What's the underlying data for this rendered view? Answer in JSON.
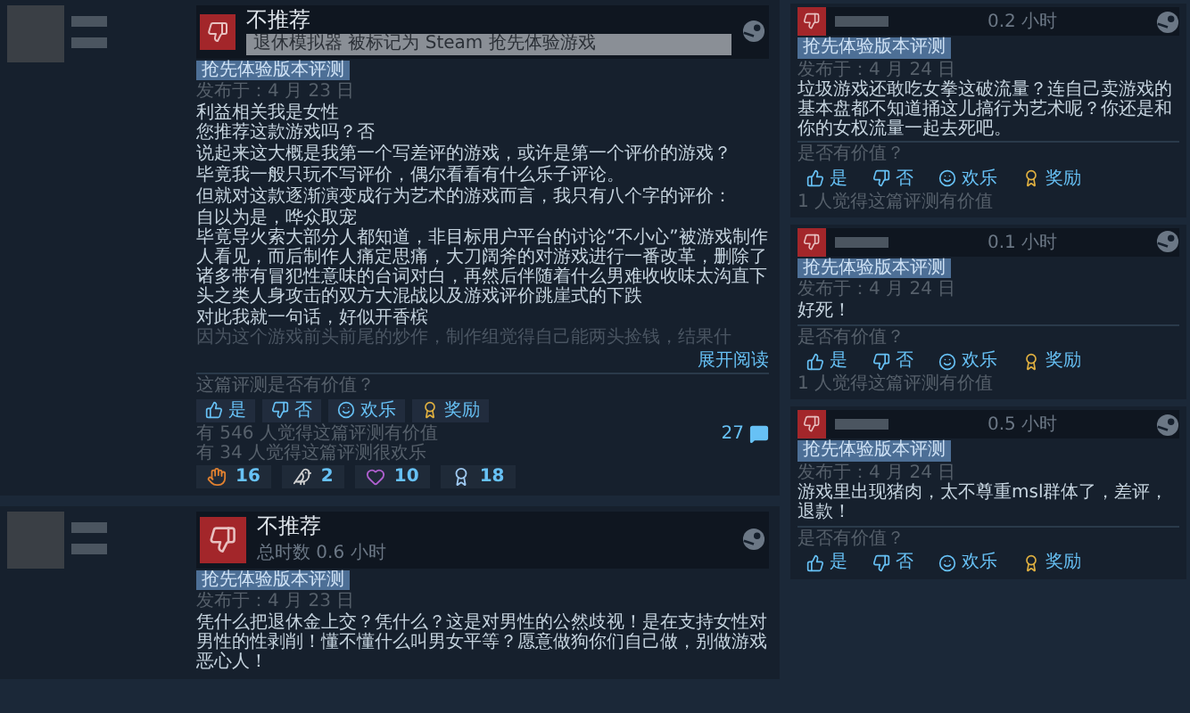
{
  "main_reviews": [
    {
      "verdict": "不推荐",
      "notice": "退休模拟器 被标记为 Steam 抢先体验游戏",
      "tag": "抢先体验版本评测",
      "date": "发布于：4 月 23 日",
      "body": [
        "利益相关我是女性",
        "您推荐这款游戏吗？否",
        "说起来这大概是我第一个写差评的游戏，或许是第一个评价的游戏？",
        "毕竟我一般只玩不写评价，偶尔看看有什么乐子评论。",
        "但就对这款逐渐演变成行为艺术的游戏而言，我只有八个字的评价：",
        "自以为是，哗众取宠",
        "毕竟导火索大部分人都知道，非目标用户平台的讨论“不小心”被游戏制作人看见，而后制作人痛定思痛，大刀阔斧的对游戏进行一番改革，删除了诸多带有冒犯性意味的台词对白，再然后伴随着什么男难收收味太沟直下头之类人身攻击的双方大混战以及游戏评价跳崖式的下跌",
        "对此我就一句话，好似开香槟"
      ],
      "faded": "因为这个游戏前头前尾的炒作，制作组觉得自己能两头捡钱，结果什",
      "expand": "展开阅读",
      "question": "这篇评测是否有价值？",
      "votes": [
        {
          "kind": "yes",
          "label": "是"
        },
        {
          "kind": "no",
          "label": "否"
        },
        {
          "kind": "funny",
          "label": "欢乐"
        },
        {
          "kind": "award",
          "label": "奖励"
        }
      ],
      "counts": [
        "有 546 人觉得这篇评测有价值",
        "有 34 人觉得这篇评测很欢乐"
      ],
      "comments": "27",
      "awards": [
        {
          "kind": "hand",
          "count": "16"
        },
        {
          "kind": "wings",
          "count": "2"
        },
        {
          "kind": "heart",
          "count": "10"
        },
        {
          "kind": "medal",
          "count": "18"
        }
      ]
    },
    {
      "verdict": "不推荐",
      "hours": "总时数 0.6 小时",
      "tag": "抢先体验版本评测",
      "date": "发布于：4 月 23 日",
      "body": [
        "凭什么把退休金上交？凭什么？这是对男性的公然歧视！是在支持女性对男性的性剥削！懂不懂什么叫男女平等？愿意做狗你们自己做，别做游戏恶心人！"
      ]
    }
  ],
  "side_reviews": [
    {
      "hours": "0.2 小时",
      "tag": "抢先体验版本评测",
      "date": "发布于：4 月 24 日",
      "body": "垃圾游戏还敢吃女拳这破流量？连自己卖游戏的基本盘都不知道捅这儿搞行为艺术呢？你还是和你的女权流量一起去死吧。",
      "question": "是否有价值？",
      "votes": [
        {
          "kind": "yes",
          "label": "是"
        },
        {
          "kind": "no",
          "label": "否"
        },
        {
          "kind": "funny",
          "label": "欢乐"
        },
        {
          "kind": "award",
          "label": "奖励"
        }
      ],
      "count": "1 人觉得这篇评测有价值"
    },
    {
      "hours": "0.1 小时",
      "tag": "抢先体验版本评测",
      "date": "发布于：4 月 24 日",
      "body": "好死！",
      "question": "是否有价值？",
      "votes": [
        {
          "kind": "yes",
          "label": "是"
        },
        {
          "kind": "no",
          "label": "否"
        },
        {
          "kind": "funny",
          "label": "欢乐"
        },
        {
          "kind": "award",
          "label": "奖励"
        }
      ],
      "count": "1 人觉得这篇评测有价值"
    },
    {
      "hours": "0.5 小时",
      "tag": "抢先体验版本评测",
      "date": "发布于：4 月 24 日",
      "body": "游戏里出现猪肉，太不尊重msl群体了，差评，退款！",
      "question": "是否有价值？",
      "votes": [
        {
          "kind": "yes",
          "label": "是"
        },
        {
          "kind": "no",
          "label": "否"
        },
        {
          "kind": "funny",
          "label": "欢乐"
        },
        {
          "kind": "award",
          "label": "奖励"
        }
      ]
    }
  ]
}
